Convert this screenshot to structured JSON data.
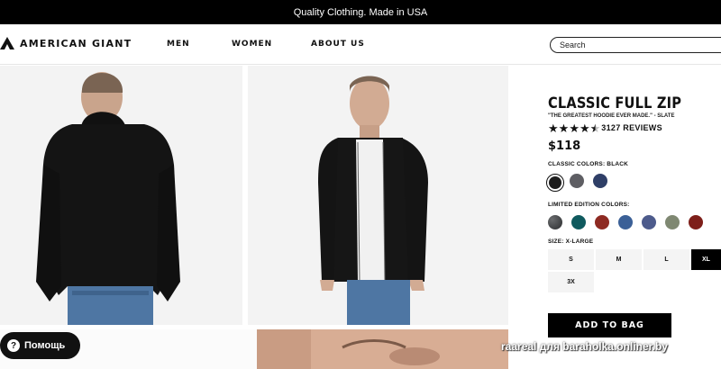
{
  "announcement": "Quality Clothing. Made in USA",
  "header": {
    "logo_text": "AMERICAN GIANT",
    "nav": [
      "MEN",
      "WOMEN",
      "ABOUT US"
    ],
    "search_placeholder": "Search"
  },
  "product": {
    "title": "CLASSIC FULL ZIP",
    "subtitle": "\"THE GREATEST HOODIE EVER MADE.\" - SLATE",
    "rating": 4.5,
    "reviews_label": "3127 REVIEWS",
    "price": "$118",
    "classic_colors_label": "CLASSIC COLORS: BLACK",
    "classic_colors": [
      "#1d1d1d",
      "#5e5e63",
      "#2f3f67"
    ],
    "limited_label": "LIMITED EDITION COLORS:",
    "limited_colors": [
      "#3b3d3f",
      "#0f5a5e",
      "#8e2a22",
      "#3b6097",
      "#4d5b8c",
      "#7f8872",
      "#7e1f1a"
    ],
    "size_label": "SIZE: X-LARGE",
    "sizes": [
      "S",
      "M",
      "L",
      "XL",
      "3X"
    ],
    "selected_size": "XL",
    "add_to_bag": "ADD TO BAG"
  },
  "help_label": "Помощь",
  "watermark": "raareal для baraholka.onliner.by"
}
